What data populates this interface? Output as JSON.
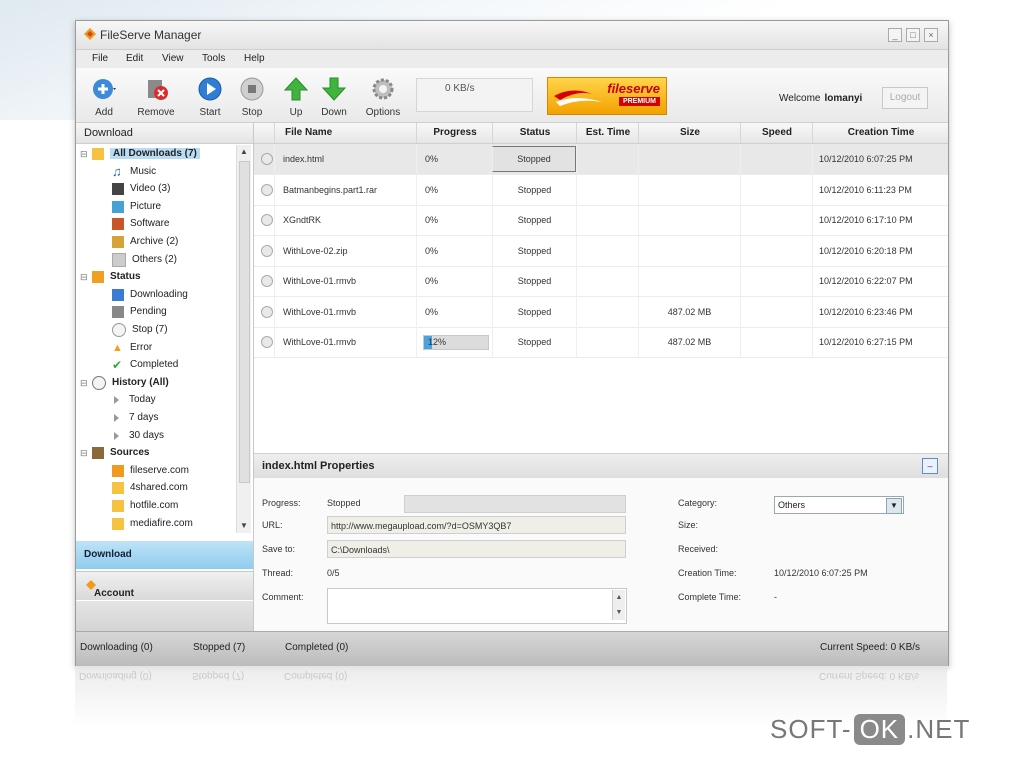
{
  "window": {
    "title": "FileServe Manager"
  },
  "menu": [
    "File",
    "Edit",
    "View",
    "Tools",
    "Help"
  ],
  "toolbar": {
    "add": "Add",
    "remove": "Remove",
    "start": "Start",
    "stop": "Stop",
    "up": "Up",
    "down": "Down",
    "options": "Options",
    "speed": "0 KB/s",
    "brand_name": "fileserve",
    "brand_tag": "PREMIUM",
    "welcome": "Welcome",
    "username": "lomanyi",
    "logout": "Logout"
  },
  "sidebar": {
    "header": "Download",
    "tree": [
      {
        "label": "All Downloads (7)",
        "icon": "folder-icon",
        "color": "#f5c242"
      },
      {
        "label": "Music",
        "icon": "music-icon",
        "color": "#2a66c9"
      },
      {
        "label": "Video (3)",
        "icon": "film-icon",
        "color": "#444444"
      },
      {
        "label": "Picture",
        "icon": "picture-icon",
        "color": "#46a2d6"
      },
      {
        "label": "Software",
        "icon": "software-icon",
        "color": "#c9552a"
      },
      {
        "label": "Archive (2)",
        "icon": "archive-icon",
        "color": "#d7a237"
      },
      {
        "label": "Others (2)",
        "icon": "document-icon",
        "color": "#cccccc"
      },
      {
        "label": "Status",
        "icon": "status-icon",
        "color": "#f0a020"
      },
      {
        "label": "Downloading",
        "icon": "downloading-icon",
        "color": "#3a7bd5"
      },
      {
        "label": "Pending",
        "icon": "hourglass-icon",
        "color": "#888888"
      },
      {
        "label": "Stop (7)",
        "icon": "stop-icon",
        "color": "#999999"
      },
      {
        "label": "Error",
        "icon": "warning-icon",
        "color": "#f0a020"
      },
      {
        "label": "Completed",
        "icon": "check-icon",
        "color": "#36a836"
      },
      {
        "label": "History (All)",
        "icon": "clock-icon",
        "color": "#777777"
      },
      {
        "label": "Today",
        "icon": "arrow-icon",
        "color": "#999999"
      },
      {
        "label": "7 days",
        "icon": "arrow-icon",
        "color": "#999999"
      },
      {
        "label": "30 days",
        "icon": "arrow-icon",
        "color": "#999999"
      },
      {
        "label": "Sources",
        "icon": "sources-icon",
        "color": "#8a6a3a"
      },
      {
        "label": "fileserve.com",
        "icon": "fileserve-icon",
        "color": "#f09a20"
      },
      {
        "label": "4shared.com",
        "icon": "folder-icon",
        "color": "#f5c242"
      },
      {
        "label": "hotfile.com",
        "icon": "folder-icon",
        "color": "#f5c242"
      },
      {
        "label": "mediafire.com",
        "icon": "folder-icon",
        "color": "#f5c242"
      }
    ],
    "nav_download": "Download",
    "nav_account": "Account"
  },
  "table": {
    "columns": [
      "File Name",
      "Progress",
      "Status",
      "Est. Time",
      "Size",
      "Speed",
      "Creation Time"
    ],
    "rows": [
      {
        "name": "index.html",
        "progress": "0%",
        "status": "Stopped",
        "est": "",
        "size": "",
        "speed": "",
        "created": "10/12/2010 6:07:25 PM"
      },
      {
        "name": "Batmanbegins.part1.rar",
        "progress": "0%",
        "status": "Stopped",
        "est": "",
        "size": "",
        "speed": "",
        "created": "10/12/2010 6:11:23 PM"
      },
      {
        "name": "XGndtRK",
        "progress": "0%",
        "status": "Stopped",
        "est": "",
        "size": "",
        "speed": "",
        "created": "10/12/2010 6:17:10 PM"
      },
      {
        "name": "WithLove-02.zip",
        "progress": "0%",
        "status": "Stopped",
        "est": "",
        "size": "",
        "speed": "",
        "created": "10/12/2010 6:20:18 PM"
      },
      {
        "name": "WithLove-01.rmvb",
        "progress": "0%",
        "status": "Stopped",
        "est": "",
        "size": "",
        "speed": "",
        "created": "10/12/2010 6:22:07 PM"
      },
      {
        "name": "WithLove-01.rmvb",
        "progress": "0%",
        "status": "Stopped",
        "est": "",
        "size": "487.02 MB",
        "speed": "",
        "created": "10/12/2010 6:23:46 PM"
      },
      {
        "name": "WithLove-01.rmvb",
        "progress": "12%",
        "progress_fraction": 0.12,
        "status": "Stopped",
        "est": "",
        "size": "487.02 MB",
        "speed": "",
        "created": "10/12/2010 6:27:15 PM"
      }
    ]
  },
  "properties": {
    "title": "index.html Properties",
    "progress_label": "Progress:",
    "progress_value": "Stopped",
    "url_label": "URL:",
    "url_value": "http://www.megaupload.com/?d=OSMY3QB7",
    "saveto_label": "Save to:",
    "saveto_value": "C:\\Downloads\\",
    "thread_label": "Thread:",
    "thread_value": "0/5",
    "comment_label": "Comment:",
    "category_label": "Category:",
    "category_value": "Others",
    "size_label": "Size:",
    "received_label": "Received:",
    "creation_label": "Creation Time:",
    "creation_value": "10/12/2010 6:07:25 PM",
    "complete_label": "Complete Time:",
    "complete_value": "-"
  },
  "statusbar": {
    "downloading": "Downloading (0)",
    "stopped": "Stopped (7)",
    "completed": "Completed (0)",
    "current_speed": "Current Speed: 0 KB/s"
  },
  "watermark": {
    "left": "SOFT-",
    "mid": "OK",
    "right": ".NET"
  }
}
